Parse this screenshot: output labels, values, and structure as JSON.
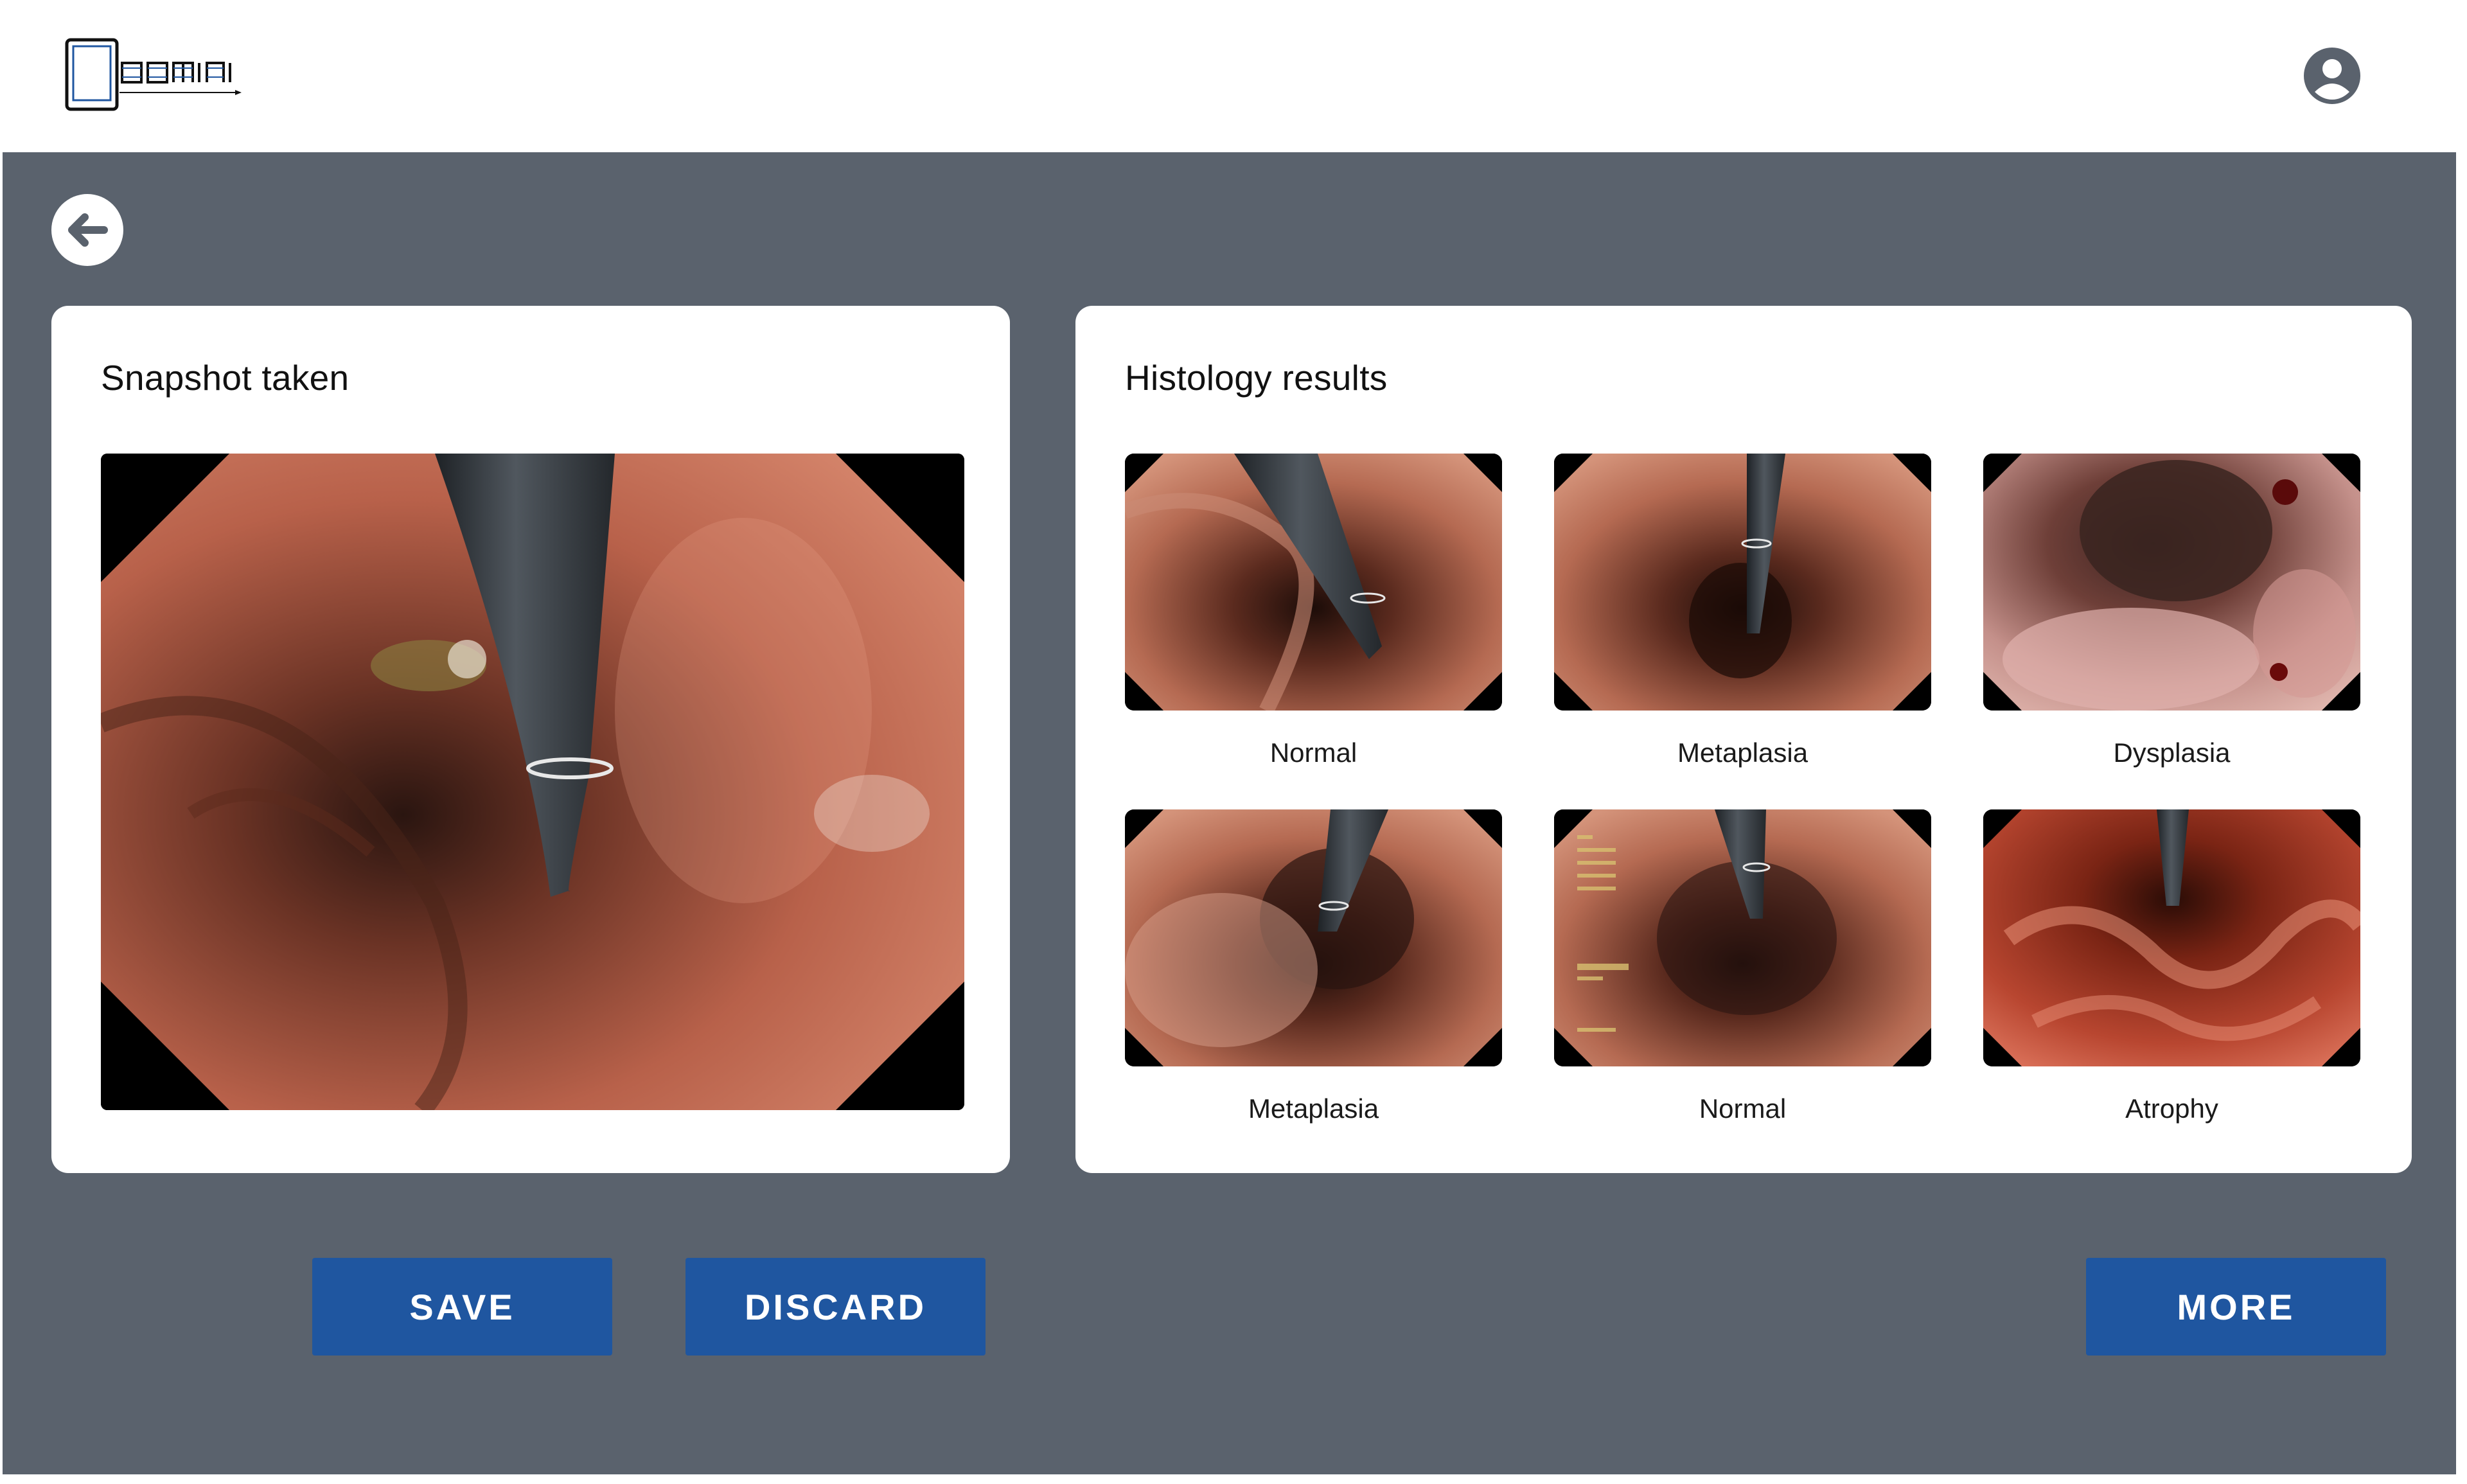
{
  "header": {
    "logo_text": "gemini",
    "logo_icon": "gemini-logo",
    "profile_icon": "account-circle-icon"
  },
  "navigation": {
    "back_icon": "arrow-left-icon"
  },
  "snapshot_card": {
    "title": "Snapshot taken"
  },
  "histology_card": {
    "title": "Histology results",
    "results": [
      {
        "label": "Normal"
      },
      {
        "label": "Metaplasia"
      },
      {
        "label": "Dysplasia"
      },
      {
        "label": "Metaplasia"
      },
      {
        "label": "Normal"
      },
      {
        "label": "Atrophy"
      }
    ]
  },
  "actions": {
    "save_label": "SAVE",
    "discard_label": "DISCARD",
    "more_label": "MORE"
  },
  "colors": {
    "background": "#5a626d",
    "card": "#ffffff",
    "button": "#1f56a0",
    "header": "#ffffff"
  }
}
